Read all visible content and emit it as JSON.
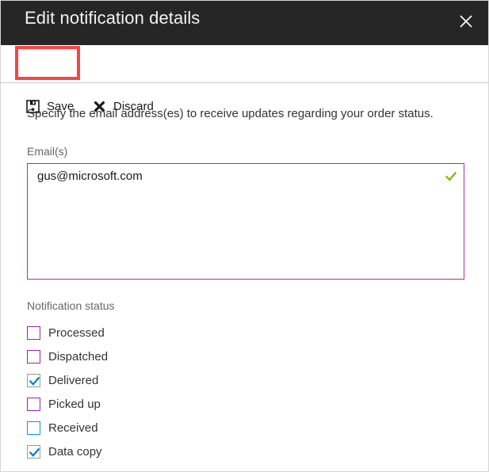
{
  "window": {
    "title": "Edit notification details",
    "close_icon": "close-icon"
  },
  "toolbar": {
    "save_label": "Save",
    "save_icon": "save-floppy-icon",
    "discard_label": "Discard",
    "discard_icon": "discard-x-icon",
    "highlight_color": "#fa4444",
    "highlighted_button": "Save"
  },
  "form": {
    "instruction": "Specify the email address(es) to receive updates regarding your order status.",
    "email": {
      "label": "Email(s)",
      "value": "gus@microsoft.com",
      "placeholder": "",
      "border_color": "#a4329b",
      "validation_icon": "green-check-icon",
      "validation_color": "#7ab800"
    },
    "notification_status": {
      "label": "Notification status",
      "items": [
        {
          "label": "Processed",
          "checked": false,
          "border": "purple"
        },
        {
          "label": "Dispatched",
          "checked": false,
          "border": "purple"
        },
        {
          "label": "Delivered",
          "checked": true,
          "border": "gray"
        },
        {
          "label": "Picked up",
          "checked": false,
          "border": "purple"
        },
        {
          "label": "Received",
          "checked": false,
          "border": "blue"
        },
        {
          "label": "Data copy",
          "checked": true,
          "border": "gray"
        }
      ],
      "check_color": "#0a7fd4",
      "purple_border": "#8f2aa5",
      "blue_border": "#0a93e0",
      "gray_border": "#9a9a9a"
    }
  }
}
